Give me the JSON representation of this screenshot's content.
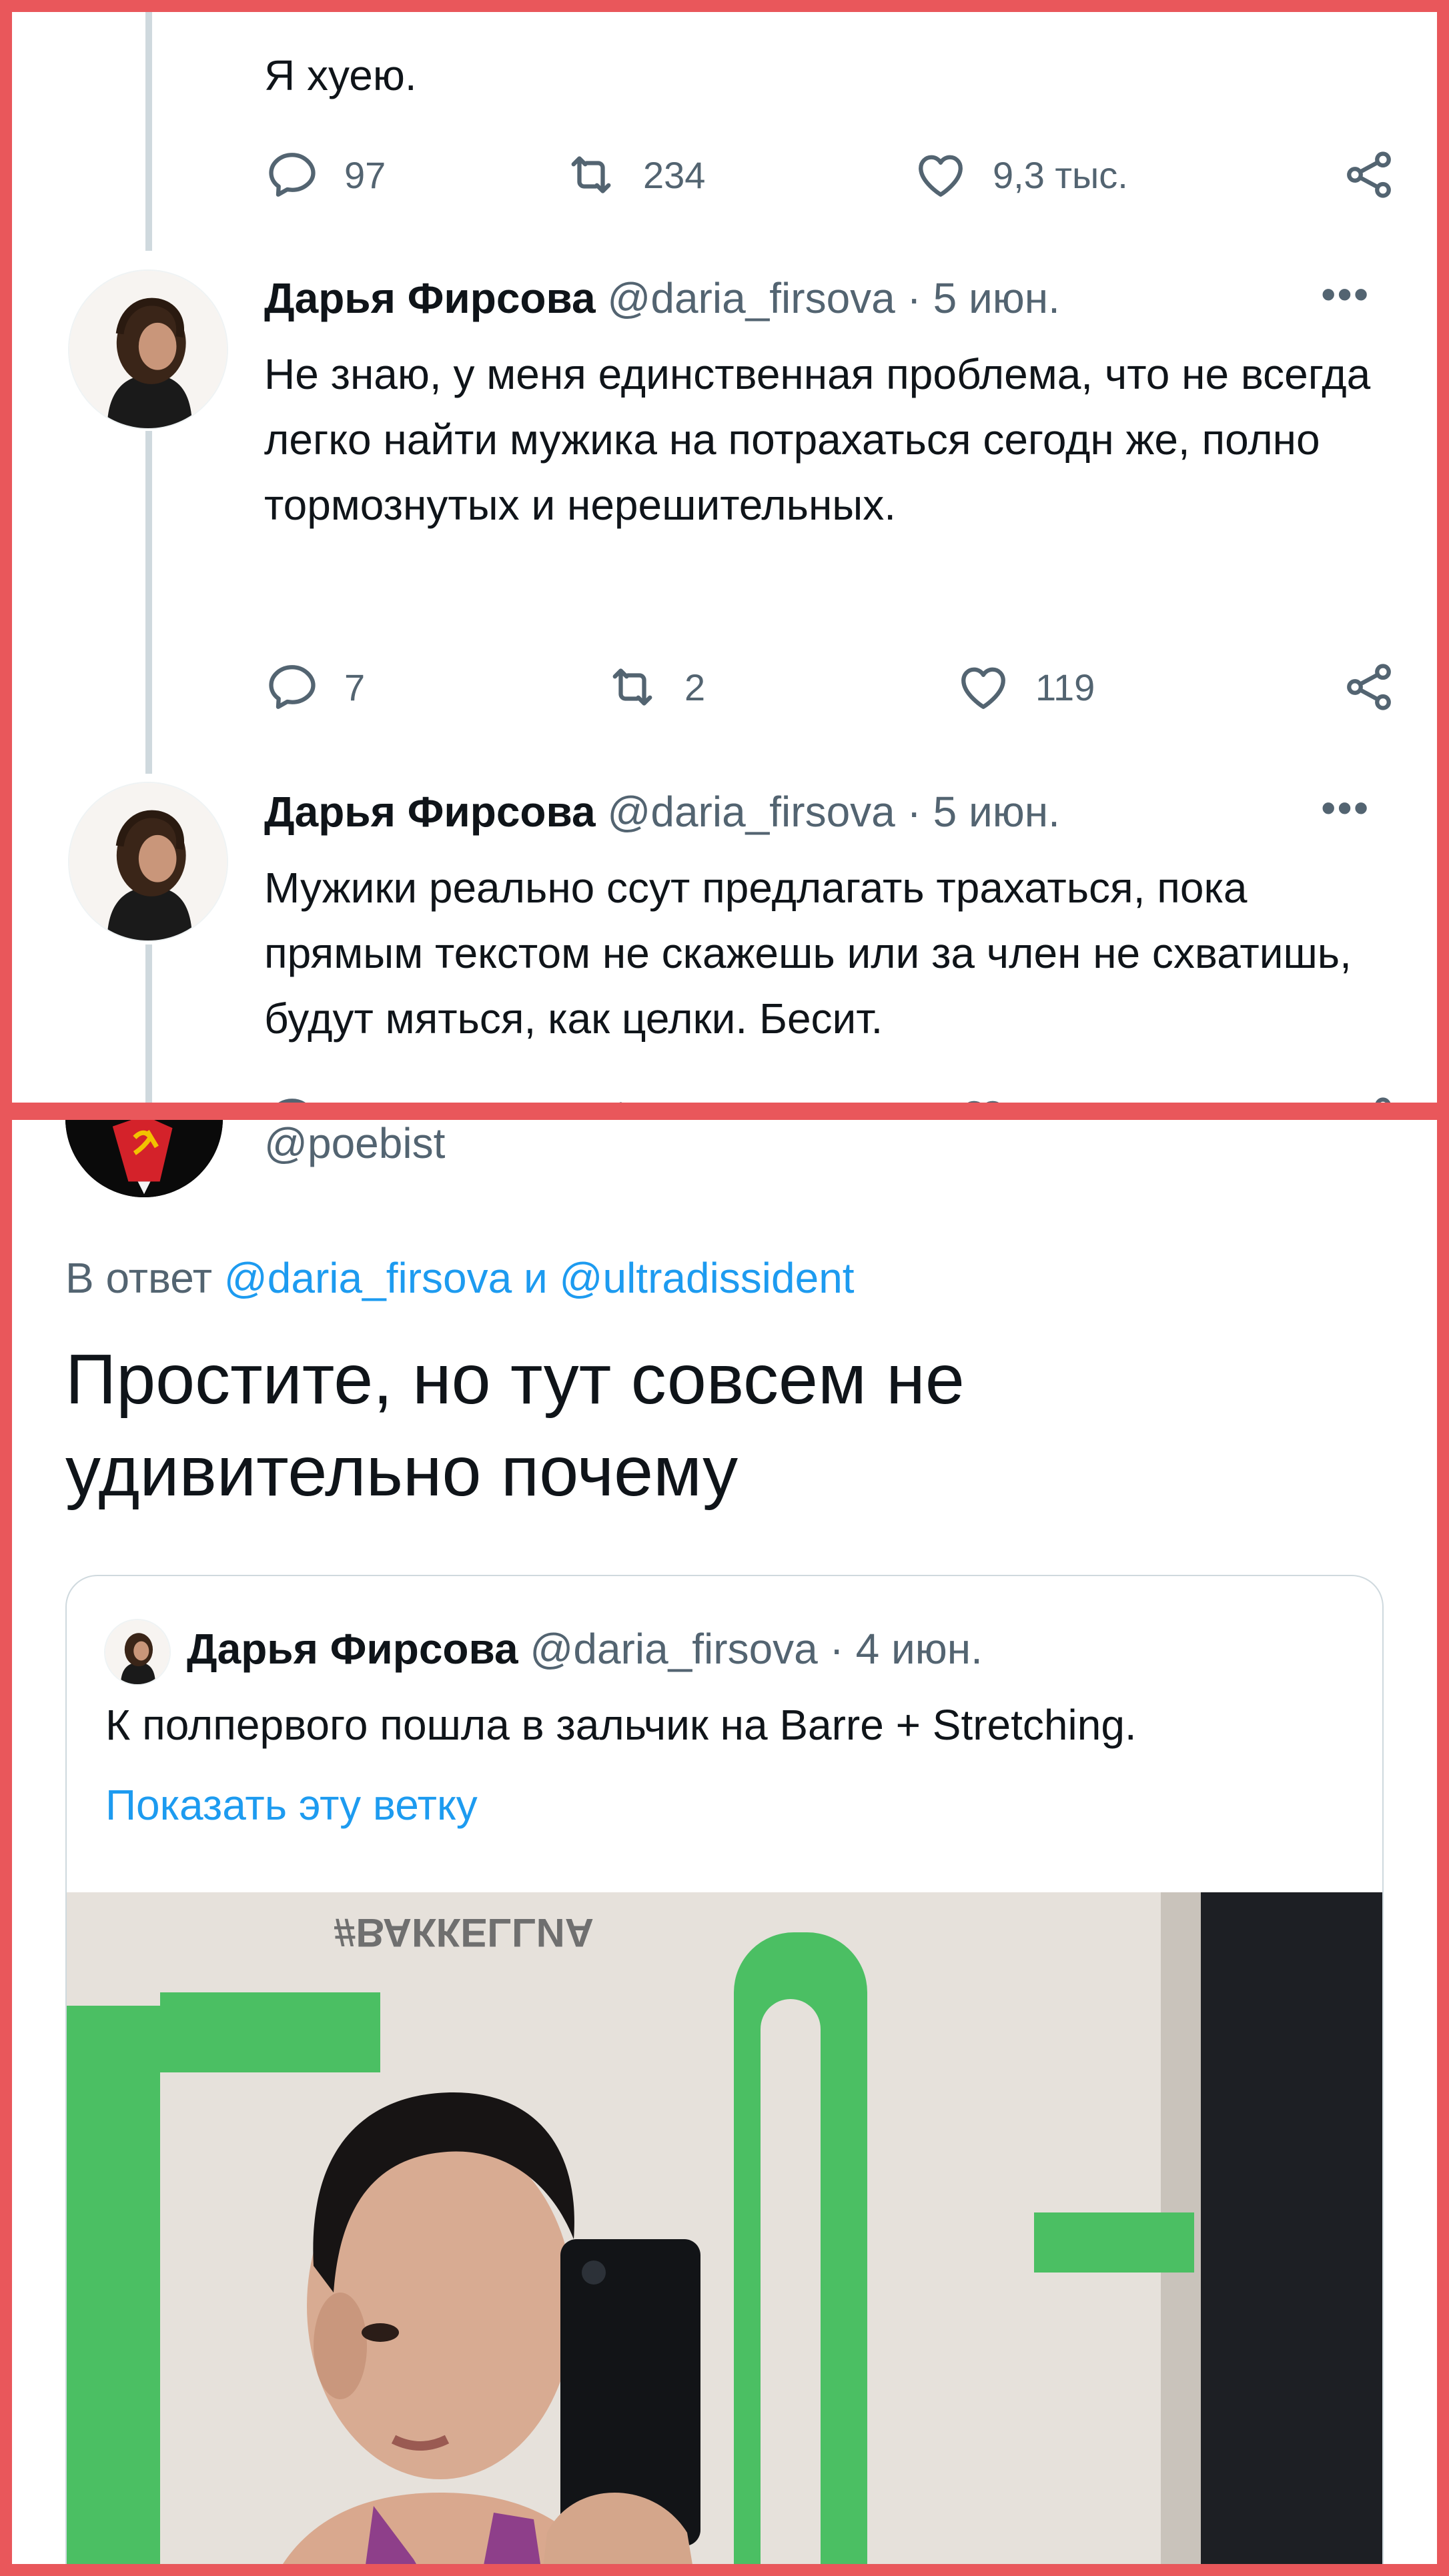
{
  "top_panel": {
    "prev_tweet": {
      "text": "Я хуею.",
      "replies": "97",
      "retweets": "234",
      "likes": "9,3 тыс."
    },
    "tweets": [
      {
        "name": "Дарья Фирсова",
        "meta": " @daria_firsova · 5 июн.",
        "text": "Не знаю, у меня единственная проблема, что не всегда легко найти мужика на потрахаться сегодн же, полно тормознутых и нерешительных.",
        "replies": "7",
        "retweets": "2",
        "likes": "119"
      },
      {
        "name": "Дарья Фирсова",
        "meta": " @daria_firsova · 5 июн.",
        "text": "Мужики реально ссут предлагать трахаться, пока прямым текстом не скажешь или за член не схватишь, будут мяться, как целки. Бесит."
      }
    ]
  },
  "bottom_panel": {
    "handle": "@poebist",
    "reply_prefix": "В ответ ",
    "reply_users": "@daria_firsova и @ultradissident",
    "main_text": "Простите, но тут совсем не удивительно почему",
    "quote": {
      "name": "Дарья Фирсова",
      "meta": " @daria_firsova · 4 июн.",
      "text": "К полпервого пошла в зальчик на Barre + Stretching.",
      "show_thread": "Показать эту ветку",
      "image_wall_text": "#ВАККЕLLИА"
    }
  },
  "colors": {
    "frame": "#e9575b",
    "link": "#1d9bf0",
    "secondary_text": "#536471",
    "border": "#cfd9de"
  },
  "icons": [
    "reply-icon",
    "retweet-icon",
    "like-icon",
    "share-icon",
    "more-icon"
  ]
}
